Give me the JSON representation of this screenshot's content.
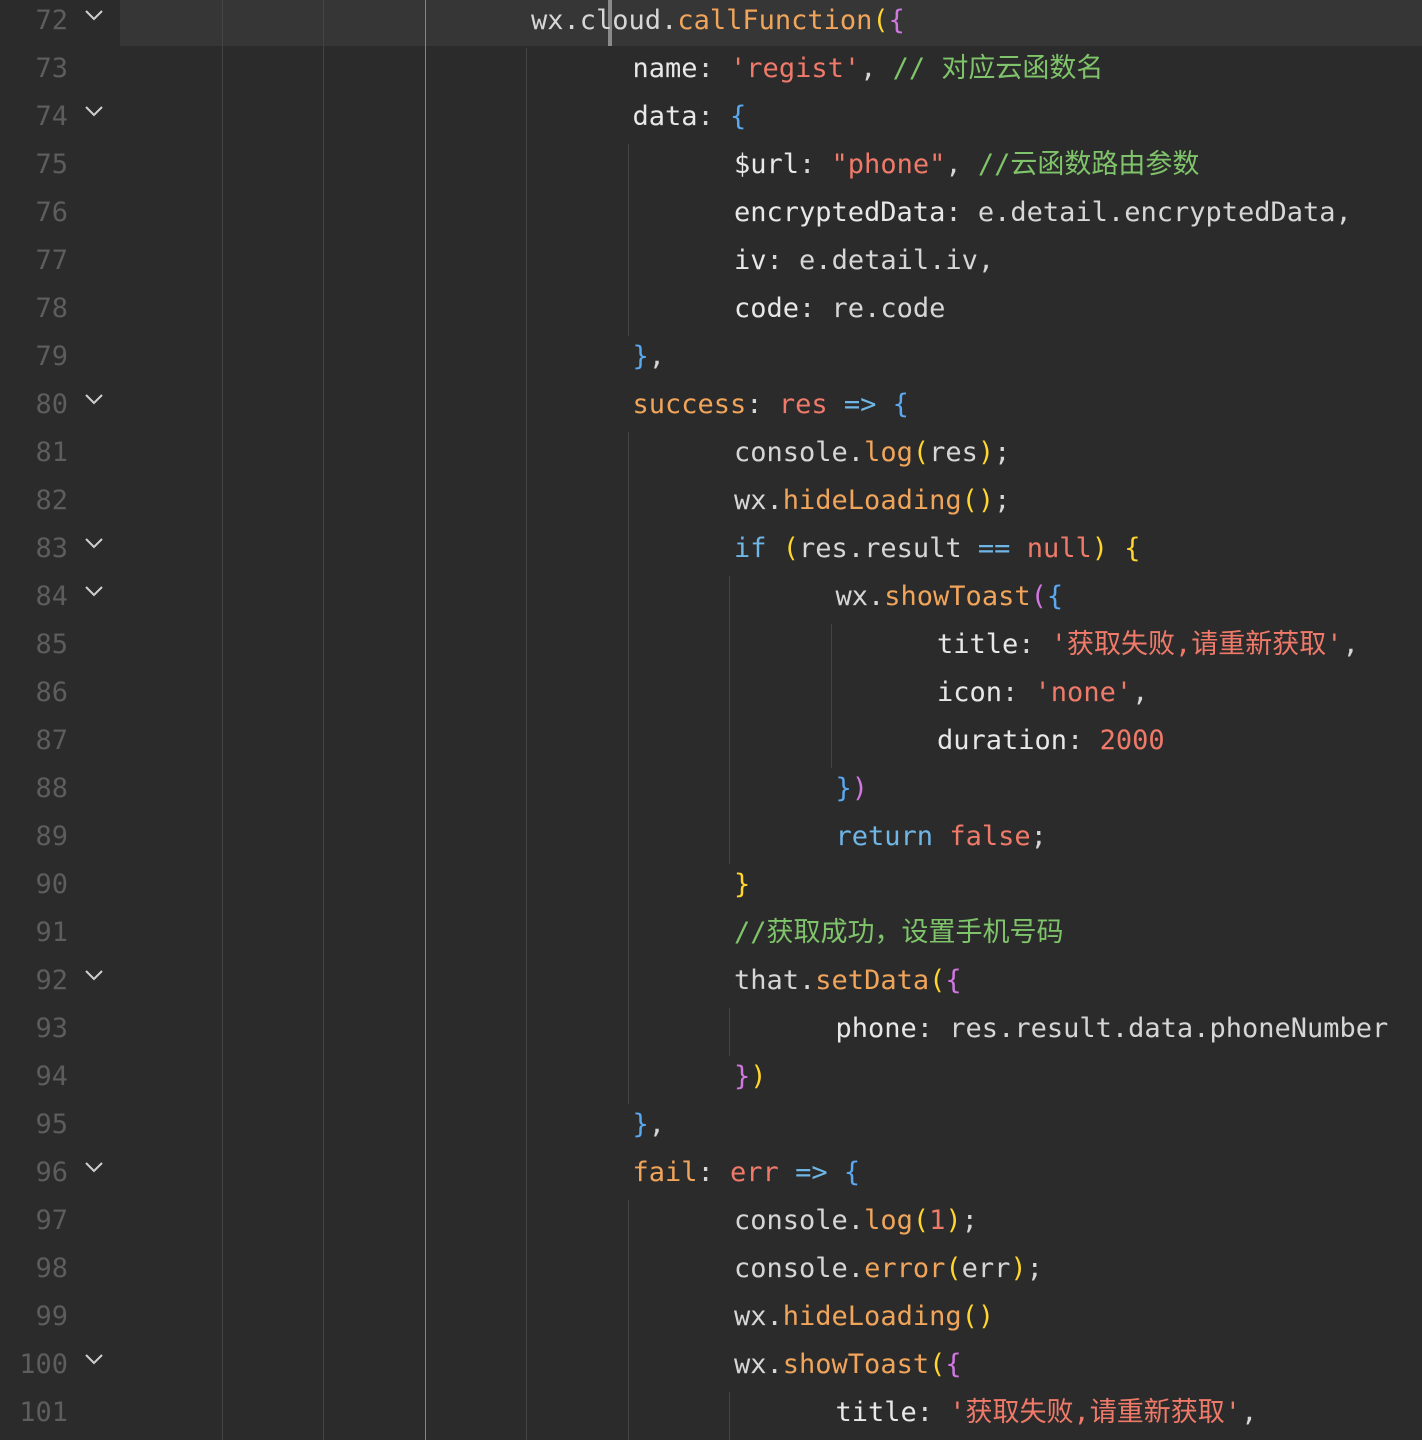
{
  "editor": {
    "theme_colors": {
      "background": "#2b2b2b",
      "line_number": "#5d5d5d",
      "function": "#f0a55b",
      "string": "#f07a6a",
      "keyword": "#6fb6e6",
      "comment": "#7fc46a",
      "text": "#d6d6d6"
    },
    "current_line": 72,
    "lines": [
      {
        "n": "72",
        "fold": true,
        "indent": 4,
        "tokens": [
          [
            "id",
            "wx"
          ],
          [
            "punc",
            "."
          ],
          [
            "id",
            "cloud"
          ],
          [
            "punc",
            "."
          ],
          [
            "fn",
            "callFunction"
          ],
          [
            "br1",
            "("
          ],
          [
            "br2",
            "{"
          ]
        ]
      },
      {
        "n": "73",
        "fold": false,
        "indent": 5,
        "tokens": [
          [
            "prop",
            "name"
          ],
          [
            "punc",
            ": "
          ],
          [
            "str",
            "'regist'"
          ],
          [
            "punc",
            ", "
          ],
          [
            "cmt",
            "// 对应云函数名"
          ]
        ]
      },
      {
        "n": "74",
        "fold": true,
        "indent": 5,
        "tokens": [
          [
            "prop",
            "data"
          ],
          [
            "punc",
            ": "
          ],
          [
            "br3",
            "{"
          ]
        ]
      },
      {
        "n": "75",
        "fold": false,
        "indent": 6,
        "tokens": [
          [
            "prop",
            "$url"
          ],
          [
            "punc",
            ": "
          ],
          [
            "str",
            "\"phone\""
          ],
          [
            "punc",
            ", "
          ],
          [
            "cmt",
            "//云函数路由参数"
          ]
        ]
      },
      {
        "n": "76",
        "fold": false,
        "indent": 6,
        "tokens": [
          [
            "prop",
            "encryptedData"
          ],
          [
            "punc",
            ": "
          ],
          [
            "id",
            "e"
          ],
          [
            "punc",
            "."
          ],
          [
            "id",
            "detail"
          ],
          [
            "punc",
            "."
          ],
          [
            "id",
            "encryptedData"
          ],
          [
            "punc",
            ","
          ]
        ]
      },
      {
        "n": "77",
        "fold": false,
        "indent": 6,
        "tokens": [
          [
            "prop",
            "iv"
          ],
          [
            "punc",
            ": "
          ],
          [
            "id",
            "e"
          ],
          [
            "punc",
            "."
          ],
          [
            "id",
            "detail"
          ],
          [
            "punc",
            "."
          ],
          [
            "id",
            "iv"
          ],
          [
            "punc",
            ","
          ]
        ]
      },
      {
        "n": "78",
        "fold": false,
        "indent": 6,
        "tokens": [
          [
            "prop",
            "code"
          ],
          [
            "punc",
            ": "
          ],
          [
            "id",
            "re"
          ],
          [
            "punc",
            "."
          ],
          [
            "id",
            "code"
          ]
        ]
      },
      {
        "n": "79",
        "fold": false,
        "indent": 5,
        "tokens": [
          [
            "br3",
            "}"
          ],
          [
            "punc",
            ","
          ]
        ]
      },
      {
        "n": "80",
        "fold": true,
        "indent": 5,
        "tokens": [
          [
            "fn",
            "success"
          ],
          [
            "punc",
            ": "
          ],
          [
            "param",
            "res"
          ],
          [
            "punc",
            " "
          ],
          [
            "kw",
            "=>"
          ],
          [
            "punc",
            " "
          ],
          [
            "br3",
            "{"
          ]
        ]
      },
      {
        "n": "81",
        "fold": false,
        "indent": 6,
        "tokens": [
          [
            "id",
            "console"
          ],
          [
            "punc",
            "."
          ],
          [
            "fn",
            "log"
          ],
          [
            "br1",
            "("
          ],
          [
            "id",
            "res"
          ],
          [
            "br1",
            ")"
          ],
          [
            "punc",
            ";"
          ]
        ]
      },
      {
        "n": "82",
        "fold": false,
        "indent": 6,
        "tokens": [
          [
            "id",
            "wx"
          ],
          [
            "punc",
            "."
          ],
          [
            "fn",
            "hideLoading"
          ],
          [
            "br1",
            "()"
          ],
          [
            "punc",
            ";"
          ]
        ]
      },
      {
        "n": "83",
        "fold": true,
        "indent": 6,
        "tokens": [
          [
            "kw",
            "if"
          ],
          [
            "punc",
            " "
          ],
          [
            "br1",
            "("
          ],
          [
            "id",
            "res"
          ],
          [
            "punc",
            "."
          ],
          [
            "id",
            "result"
          ],
          [
            "punc",
            " "
          ],
          [
            "kw",
            "=="
          ],
          [
            "punc",
            " "
          ],
          [
            "bool",
            "null"
          ],
          [
            "br1",
            ")"
          ],
          [
            "punc",
            " "
          ],
          [
            "br1",
            "{"
          ]
        ]
      },
      {
        "n": "84",
        "fold": true,
        "indent": 7,
        "tokens": [
          [
            "id",
            "wx"
          ],
          [
            "punc",
            "."
          ],
          [
            "fn",
            "showToast"
          ],
          [
            "br2",
            "("
          ],
          [
            "br3",
            "{"
          ]
        ]
      },
      {
        "n": "85",
        "fold": false,
        "indent": 8,
        "tokens": [
          [
            "prop",
            "title"
          ],
          [
            "punc",
            ": "
          ],
          [
            "str",
            "'获取失败,请重新获取'"
          ],
          [
            "punc",
            ","
          ]
        ]
      },
      {
        "n": "86",
        "fold": false,
        "indent": 8,
        "tokens": [
          [
            "prop",
            "icon"
          ],
          [
            "punc",
            ": "
          ],
          [
            "str",
            "'none'"
          ],
          [
            "punc",
            ","
          ]
        ]
      },
      {
        "n": "87",
        "fold": false,
        "indent": 8,
        "tokens": [
          [
            "prop",
            "duration"
          ],
          [
            "punc",
            ": "
          ],
          [
            "num",
            "2000"
          ]
        ]
      },
      {
        "n": "88",
        "fold": false,
        "indent": 7,
        "tokens": [
          [
            "br3",
            "}"
          ],
          [
            "br2",
            ")"
          ]
        ]
      },
      {
        "n": "89",
        "fold": false,
        "indent": 7,
        "tokens": [
          [
            "kw",
            "return"
          ],
          [
            "punc",
            " "
          ],
          [
            "bool",
            "false"
          ],
          [
            "punc",
            ";"
          ]
        ]
      },
      {
        "n": "90",
        "fold": false,
        "indent": 6,
        "tokens": [
          [
            "br1",
            "}"
          ]
        ]
      },
      {
        "n": "91",
        "fold": false,
        "indent": 6,
        "tokens": [
          [
            "cmt",
            "//获取成功，设置手机号码"
          ]
        ]
      },
      {
        "n": "92",
        "fold": true,
        "indent": 6,
        "tokens": [
          [
            "id",
            "that"
          ],
          [
            "punc",
            "."
          ],
          [
            "fn",
            "setData"
          ],
          [
            "br1",
            "("
          ],
          [
            "br2",
            "{"
          ]
        ]
      },
      {
        "n": "93",
        "fold": false,
        "indent": 7,
        "tokens": [
          [
            "prop",
            "phone"
          ],
          [
            "punc",
            ": "
          ],
          [
            "id",
            "res"
          ],
          [
            "punc",
            "."
          ],
          [
            "id",
            "result"
          ],
          [
            "punc",
            "."
          ],
          [
            "id",
            "data"
          ],
          [
            "punc",
            "."
          ],
          [
            "id",
            "phoneNumber"
          ]
        ]
      },
      {
        "n": "94",
        "fold": false,
        "indent": 6,
        "tokens": [
          [
            "br2",
            "}"
          ],
          [
            "br1",
            ")"
          ]
        ]
      },
      {
        "n": "95",
        "fold": false,
        "indent": 5,
        "tokens": [
          [
            "br3",
            "}"
          ],
          [
            "punc",
            ","
          ]
        ]
      },
      {
        "n": "96",
        "fold": true,
        "indent": 5,
        "tokens": [
          [
            "fn",
            "fail"
          ],
          [
            "punc",
            ": "
          ],
          [
            "param",
            "err"
          ],
          [
            "punc",
            " "
          ],
          [
            "kw",
            "=>"
          ],
          [
            "punc",
            " "
          ],
          [
            "br3",
            "{"
          ]
        ]
      },
      {
        "n": "97",
        "fold": false,
        "indent": 6,
        "tokens": [
          [
            "id",
            "console"
          ],
          [
            "punc",
            "."
          ],
          [
            "fn",
            "log"
          ],
          [
            "br1",
            "("
          ],
          [
            "num",
            "1"
          ],
          [
            "br1",
            ")"
          ],
          [
            "punc",
            ";"
          ]
        ]
      },
      {
        "n": "98",
        "fold": false,
        "indent": 6,
        "tokens": [
          [
            "id",
            "console"
          ],
          [
            "punc",
            "."
          ],
          [
            "fn",
            "error"
          ],
          [
            "br1",
            "("
          ],
          [
            "id",
            "err"
          ],
          [
            "br1",
            ")"
          ],
          [
            "punc",
            ";"
          ]
        ]
      },
      {
        "n": "99",
        "fold": false,
        "indent": 6,
        "tokens": [
          [
            "id",
            "wx"
          ],
          [
            "punc",
            "."
          ],
          [
            "fn",
            "hideLoading"
          ],
          [
            "br1",
            "()"
          ]
        ]
      },
      {
        "n": "100",
        "fold": true,
        "indent": 6,
        "tokens": [
          [
            "id",
            "wx"
          ],
          [
            "punc",
            "."
          ],
          [
            "fn",
            "showToast"
          ],
          [
            "br1",
            "("
          ],
          [
            "br2",
            "{"
          ]
        ]
      },
      {
        "n": "101",
        "fold": false,
        "indent": 7,
        "tokens": [
          [
            "prop",
            "title"
          ],
          [
            "punc",
            ": "
          ],
          [
            "str",
            "'获取失败,请重新获取'"
          ],
          [
            "punc",
            ","
          ]
        ]
      }
    ]
  }
}
